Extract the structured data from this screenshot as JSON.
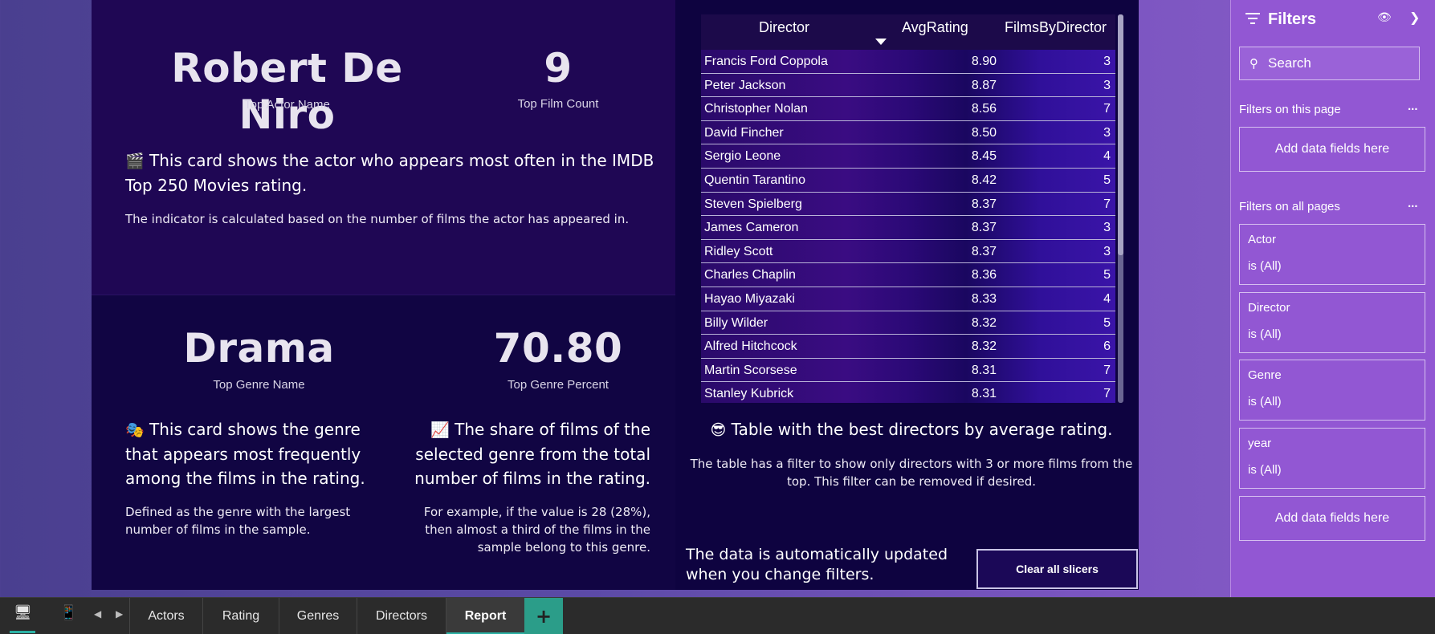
{
  "kpis": {
    "top_actor_name": "Robert De Niro",
    "top_actor_label": "Top Actor Name",
    "top_film_count": "9",
    "top_film_count_label": "Top Film Count",
    "top_genre_name": "Drama",
    "top_genre_label": "Top Genre Name",
    "top_genre_percent": "70.80",
    "top_genre_percent_label": "Top Genre Percent"
  },
  "descriptions": {
    "actor_card_emoji": "🎬",
    "actor_card_title": "This card shows the actor who appears most often in the IMDB Top 250 Movies rating.",
    "actor_card_note": "The indicator is calculated based on the number of films the actor has appeared in.",
    "genre_card_emoji": "🎭",
    "genre_card_title": "This card shows the genre that appears most frequently among the films in the rating.",
    "genre_card_note": "Defined as the genre with the largest number of films in the sample.",
    "percent_card_emoji": "📈",
    "percent_card_title": "The share of films of the selected genre from the total number of films in the rating.",
    "percent_card_note": "For example, if the value is 28 (28%), then almost a third of the films in the sample belong to this genre.",
    "table_emoji": "😎",
    "table_title": "Table with the best directors by average rating.",
    "table_note": "The table has a filter to show only directors with 3 or more films from the top. This filter can be removed if desired.",
    "auto_update_note": "The data is automatically updated when you change filters."
  },
  "table": {
    "columns": [
      "Director",
      "AvgRating",
      "FilmsByDirector"
    ],
    "sorted_column": "AvgRating",
    "rows": [
      [
        "Francis Ford Coppola",
        "8.90",
        "3"
      ],
      [
        "Peter Jackson",
        "8.87",
        "3"
      ],
      [
        "Christopher Nolan",
        "8.56",
        "7"
      ],
      [
        "David Fincher",
        "8.50",
        "3"
      ],
      [
        "Sergio Leone",
        "8.45",
        "4"
      ],
      [
        "Quentin Tarantino",
        "8.42",
        "5"
      ],
      [
        "Steven Spielberg",
        "8.37",
        "7"
      ],
      [
        "James Cameron",
        "8.37",
        "3"
      ],
      [
        "Ridley Scott",
        "8.37",
        "3"
      ],
      [
        "Charles Chaplin",
        "8.36",
        "5"
      ],
      [
        "Hayao Miyazaki",
        "8.33",
        "4"
      ],
      [
        "Billy Wilder",
        "8.32",
        "5"
      ],
      [
        "Alfred Hitchcock",
        "8.32",
        "6"
      ],
      [
        "Martin Scorsese",
        "8.31",
        "7"
      ],
      [
        "Stanley Kubrick",
        "8.31",
        "7"
      ]
    ]
  },
  "clear_button_label": "Clear all slicers",
  "filters_pane": {
    "title": "Filters",
    "search_placeholder": "Search",
    "section_page": "Filters on this page",
    "section_all": "Filters on all pages",
    "more_label": "...",
    "add_fields_label": "Add data fields here",
    "cards": [
      {
        "field": "Actor",
        "value": "is (All)"
      },
      {
        "field": "Director",
        "value": "is (All)"
      },
      {
        "field": "Genre",
        "value": "is (All)"
      },
      {
        "field": "year",
        "value": "is (All)"
      }
    ]
  },
  "tabs": {
    "items": [
      "Actors",
      "Rating",
      "Genres",
      "Directors",
      "Report"
    ],
    "active": "Report",
    "add_label": "+"
  },
  "colors": {
    "canvas_bg": "#0f0444",
    "filters_bg": "#9257d3",
    "tab_accent": "#2bb1a4",
    "tabbar_bg": "#2b2b2b"
  },
  "icons": {
    "filters": "filter-lines-icon",
    "eye": "eye-icon",
    "collapse": "chevron-right-icon",
    "search": "search-icon",
    "desktop": "desktop-icon",
    "mobile": "mobile-icon"
  }
}
